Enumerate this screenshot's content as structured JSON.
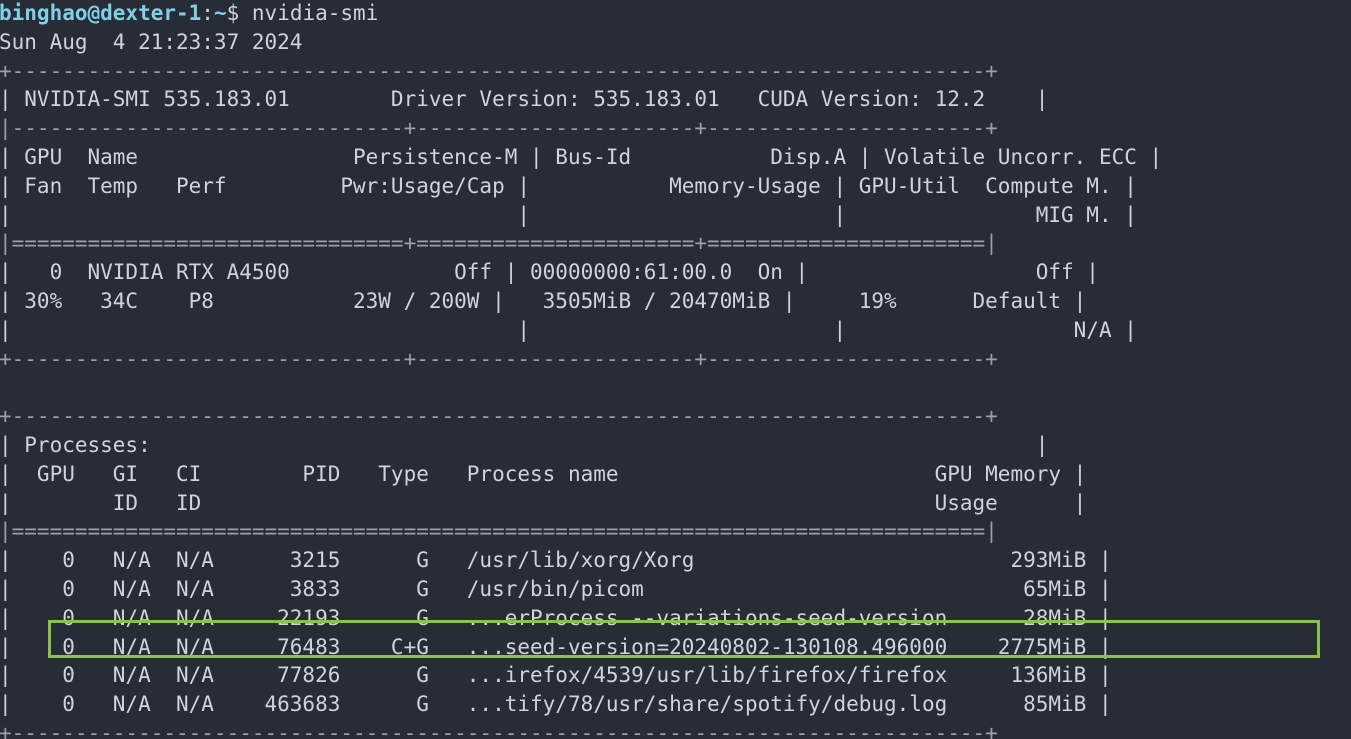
{
  "prompt": {
    "user_host": "binghao@dexter-1",
    "separator": ":",
    "cwd": "~",
    "symbol": "$ ",
    "command": "nvidia-smi"
  },
  "timestamp": "Sun Aug  4 21:23:37 2024",
  "border": {
    "top": "+-----------------------------------------------------------------------------+",
    "header_sep": "|-------------------------------+----------------------+----------------------+",
    "gpu_eq": "|===============================+======================+======================|",
    "gpu_end": "+-------------------------------+----------------------+----------------------+",
    "proc_top": "+-----------------------------------------------------------------------------+",
    "proc_eq": "|=============================================================================|",
    "bottom": "+-----------------------------------------------------------------------------+"
  },
  "header": {
    "line": "| NVIDIA-SMI 535.183.01        Driver Version: 535.183.01   CUDA Version: 12.2    |"
  },
  "gpu_columns": [
    "| GPU  Name                 Persistence-M | Bus-Id           Disp.A | Volatile Uncorr. ECC |",
    "| Fan  Temp   Perf         Pwr:Usage/Cap |           Memory-Usage | GPU-Util  Compute M. |",
    "|                                        |                        |               MIG M. |"
  ],
  "gpu_rows": [
    "|   0  NVIDIA RTX A4500             Off | 00000000:61:00.0  On |                  Off |",
    "| 30%   34C    P8           23W / 200W |   3505MiB / 20470MiB |     19%      Default |",
    "|                                        |                        |                  N/A |"
  ],
  "blank": "",
  "processes": {
    "title": "| Processes:                                                                      |",
    "columns": [
      "|  GPU   GI   CI        PID   Type   Process name                         GPU Memory |",
      "|        ID   ID                                                          Usage      |"
    ],
    "rows": [
      "|    0   N/A  N/A      3215      G   /usr/lib/xorg/Xorg                         293MiB |",
      "|    0   N/A  N/A      3833      G   /usr/bin/picom                              65MiB |",
      "|    0   N/A  N/A     22193      G   ...erProcess --variations-seed-version      28MiB |",
      "|    0   N/A  N/A     76483    C+G   ...seed-version=20240802-130108.496000    2775MiB |",
      "|    0   N/A  N/A     77826      G   ...irefox/4539/usr/lib/firefox/firefox     136MiB |",
      "|    0   N/A  N/A    463683      G   ...tify/78/usr/share/spotify/debug.log      85MiB |"
    ]
  },
  "highlight_color": "#8bc34a"
}
